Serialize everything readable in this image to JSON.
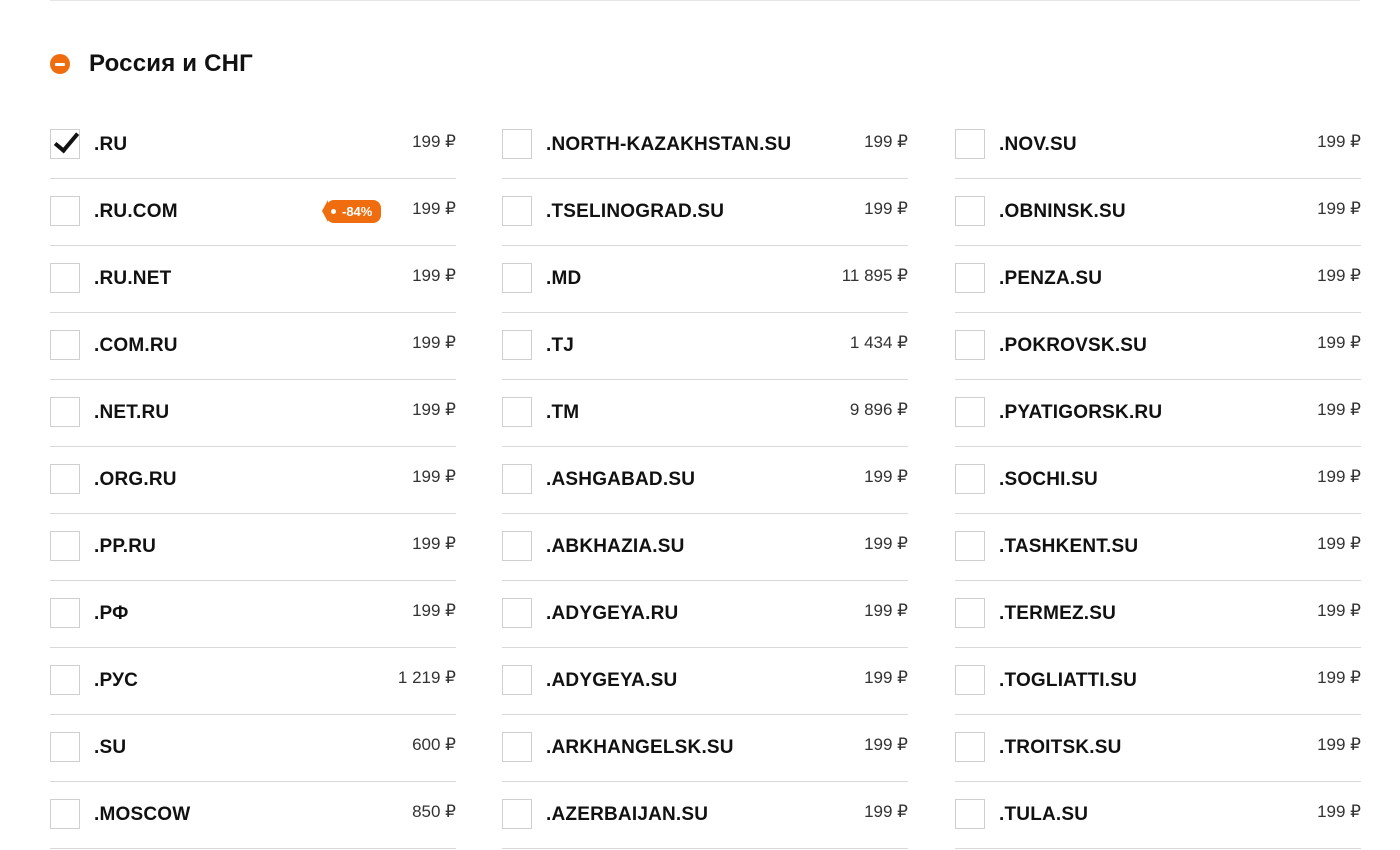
{
  "section": {
    "title": "Россия и СНГ",
    "icon": "minus-circle-icon",
    "accent_color": "#f06d0f"
  },
  "columns": [
    {
      "rows": [
        {
          "domain": ".RU",
          "price": "199 ₽",
          "checked": true
        },
        {
          "domain": ".RU.COM",
          "price": "199 ₽",
          "badge": "-84%"
        },
        {
          "domain": ".RU.NET",
          "price": "199 ₽"
        },
        {
          "domain": ".COM.RU",
          "price": "199 ₽"
        },
        {
          "domain": ".NET.RU",
          "price": "199 ₽"
        },
        {
          "domain": ".ORG.RU",
          "price": "199 ₽"
        },
        {
          "domain": ".PP.RU",
          "price": "199 ₽"
        },
        {
          "domain": ".РФ",
          "price": "199 ₽"
        },
        {
          "domain": ".РУС",
          "price": "1 219 ₽"
        },
        {
          "domain": ".SU",
          "price": "600 ₽"
        },
        {
          "domain": ".MOSCOW",
          "price": "850 ₽"
        }
      ]
    },
    {
      "rows": [
        {
          "domain": ".NORTH-KAZAKHSTAN.SU",
          "price": "199 ₽"
        },
        {
          "domain": ".TSELINOGRAD.SU",
          "price": "199 ₽"
        },
        {
          "domain": ".MD",
          "price": "11 895 ₽"
        },
        {
          "domain": ".TJ",
          "price": "1 434 ₽"
        },
        {
          "domain": ".TM",
          "price": "9 896 ₽"
        },
        {
          "domain": ".ASHGABAD.SU",
          "price": "199 ₽"
        },
        {
          "domain": ".ABKHAZIA.SU",
          "price": "199 ₽"
        },
        {
          "domain": ".ADYGEYA.RU",
          "price": "199 ₽"
        },
        {
          "domain": ".ADYGEYA.SU",
          "price": "199 ₽"
        },
        {
          "domain": ".ARKHANGELSK.SU",
          "price": "199 ₽"
        },
        {
          "domain": ".AZERBAIJAN.SU",
          "price": "199 ₽"
        }
      ]
    },
    {
      "rows": [
        {
          "domain": ".NOV.SU",
          "price": "199 ₽"
        },
        {
          "domain": ".OBNINSK.SU",
          "price": "199 ₽"
        },
        {
          "domain": ".PENZA.SU",
          "price": "199 ₽"
        },
        {
          "domain": ".POKROVSK.SU",
          "price": "199 ₽"
        },
        {
          "domain": ".PYATIGORSK.RU",
          "price": "199 ₽"
        },
        {
          "domain": ".SOCHI.SU",
          "price": "199 ₽"
        },
        {
          "domain": ".TASHKENT.SU",
          "price": "199 ₽"
        },
        {
          "domain": ".TERMEZ.SU",
          "price": "199 ₽"
        },
        {
          "domain": ".TOGLIATTI.SU",
          "price": "199 ₽"
        },
        {
          "domain": ".TROITSK.SU",
          "price": "199 ₽"
        },
        {
          "domain": ".TULA.SU",
          "price": "199 ₽"
        }
      ]
    }
  ]
}
